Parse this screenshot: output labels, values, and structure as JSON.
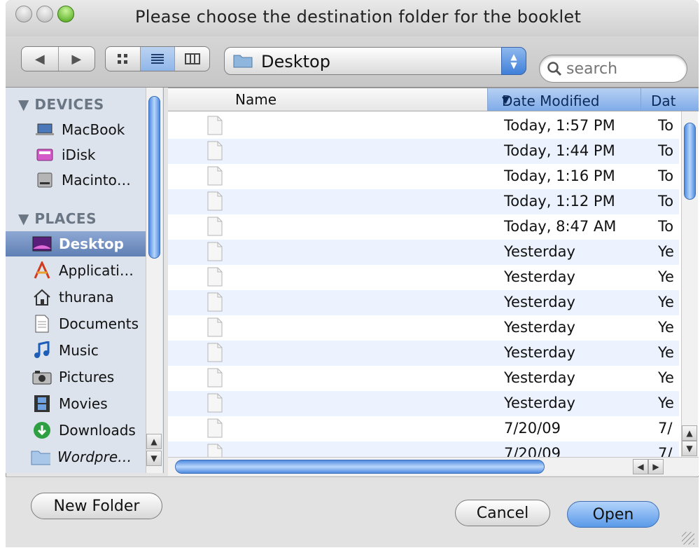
{
  "window": {
    "title": "Please choose the destination folder for the booklet"
  },
  "toolbar": {
    "back_icon": "triangle-left",
    "forward_icon": "triangle-right",
    "view_modes": [
      "icon-view",
      "list-view",
      "column-view"
    ],
    "active_view": "list-view",
    "location": "Desktop",
    "search_placeholder": "search"
  },
  "sidebar": {
    "devices_header": "DEVICES",
    "places_header": "PLACES",
    "devices": [
      {
        "label": "MacBook",
        "icon": "laptop-icon"
      },
      {
        "label": "iDisk",
        "icon": "idisk-icon"
      },
      {
        "label": "Macinto…",
        "icon": "hard-drive-icon"
      }
    ],
    "places": [
      {
        "label": "Desktop",
        "icon": "desktop-icon",
        "selected": true
      },
      {
        "label": "Applicati…",
        "icon": "applications-icon"
      },
      {
        "label": "thurana",
        "icon": "home-icon"
      },
      {
        "label": "Documents",
        "icon": "documents-icon"
      },
      {
        "label": "Music",
        "icon": "music-icon"
      },
      {
        "label": "Pictures",
        "icon": "camera-icon"
      },
      {
        "label": "Movies",
        "icon": "film-icon"
      },
      {
        "label": "Downloads",
        "icon": "downloads-icon"
      },
      {
        "label": "Wordpre…",
        "icon": "folder-icon"
      }
    ]
  },
  "file_list": {
    "columns": {
      "name": "Name",
      "date_modified": "Date Modified",
      "date_created_truncated": "Dat"
    },
    "rows": [
      {
        "date_modified": "Today, 1:57 PM",
        "date2": "To"
      },
      {
        "date_modified": "Today, 1:44 PM",
        "date2": "To"
      },
      {
        "date_modified": "Today, 1:16 PM",
        "date2": "To"
      },
      {
        "date_modified": "Today, 1:12 PM",
        "date2": "To"
      },
      {
        "date_modified": "Today, 8:47 AM",
        "date2": "To"
      },
      {
        "date_modified": "Yesterday",
        "date2": "Ye"
      },
      {
        "date_modified": "Yesterday",
        "date2": "Ye"
      },
      {
        "date_modified": "Yesterday",
        "date2": "Ye"
      },
      {
        "date_modified": "Yesterday",
        "date2": "Ye"
      },
      {
        "date_modified": "Yesterday",
        "date2": "Ye"
      },
      {
        "date_modified": "Yesterday",
        "date2": "Ye"
      },
      {
        "date_modified": "Yesterday",
        "date2": "Ye"
      },
      {
        "date_modified": "7/20/09",
        "date2": "7/"
      },
      {
        "date_modified": "7/20/09",
        "date2": "7/"
      }
    ]
  },
  "buttons": {
    "new_folder": "New Folder",
    "cancel": "Cancel",
    "open": "Open"
  },
  "colors": {
    "accent": "#5a9ae8",
    "selection": "#6f8ec2",
    "row_alt": "#edf3fe"
  }
}
